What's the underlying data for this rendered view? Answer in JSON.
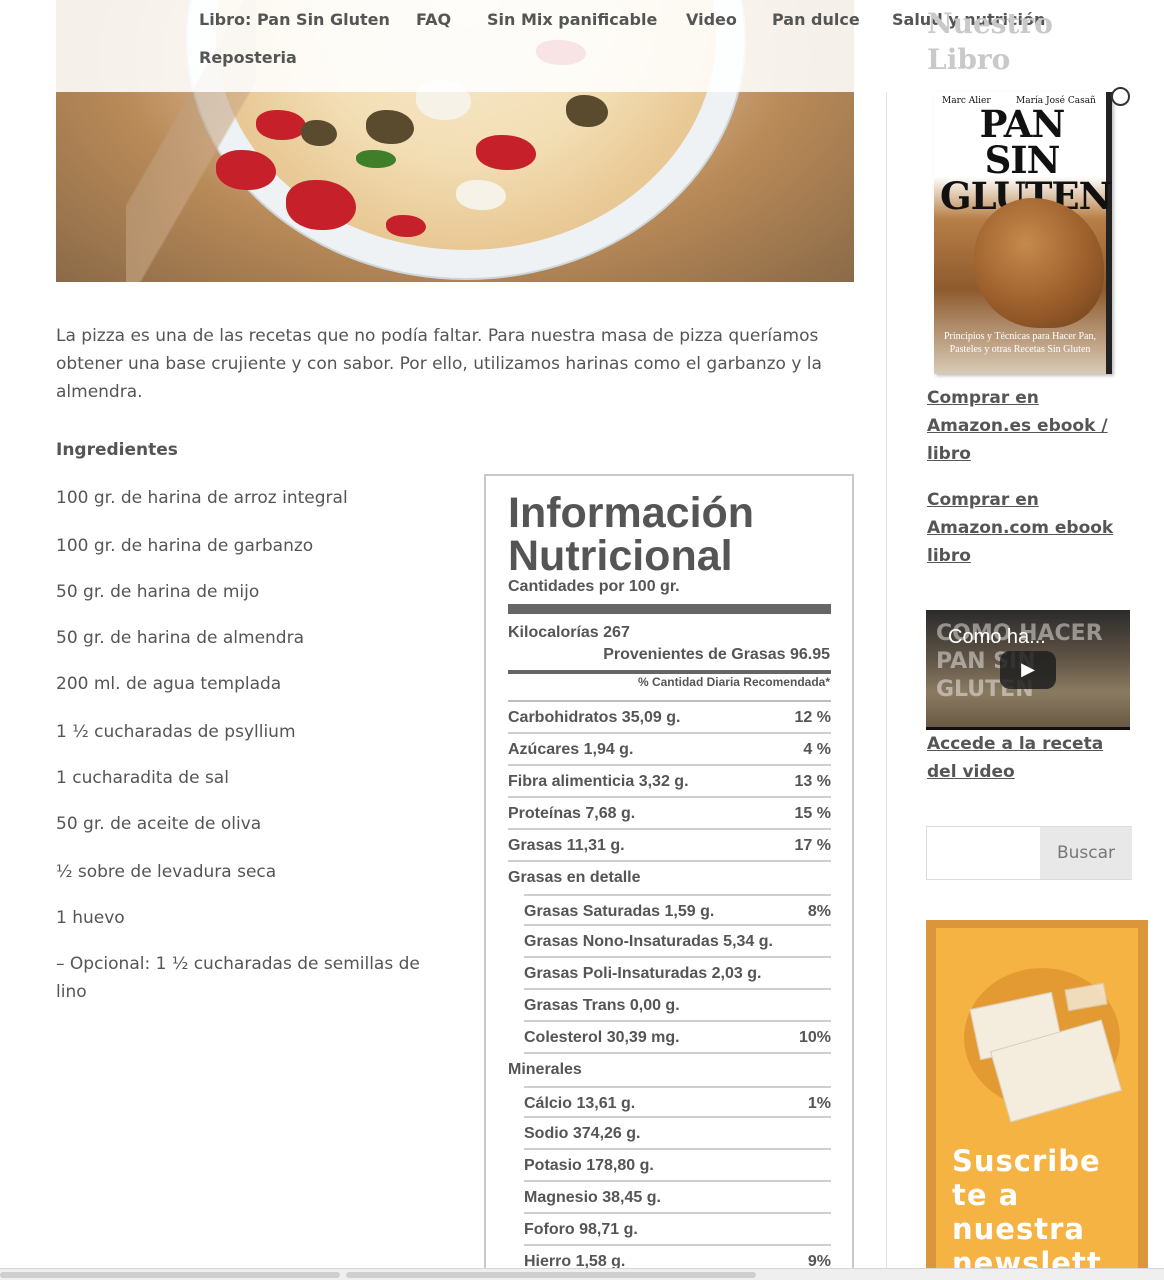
{
  "nav": {
    "items": [
      "Libro: Pan Sin Gluten",
      "FAQ",
      "Sin Mix panificable",
      "Video",
      "Pan dulce",
      "Salud y nutrición",
      "Reposteria"
    ]
  },
  "article": {
    "intro": "La pizza es una de las recetas que no podía faltar. Para nuestra masa de pizza queríamos obtener una base crujiente y con sabor. Por ello, utilizamos harinas como el garbanzo y la almendra.",
    "ingredients_title": "Ingredientes",
    "ingredients": [
      "100 gr. de harina de arroz integral",
      "100 gr. de harina de garbanzo",
      "50 gr. de harina de mijo",
      "50 gr. de harina de almendra",
      "200 ml. de agua templada",
      "1 ½  cucharadas de psyllium",
      "1 cucharadita de sal",
      "50 gr. de aceite de oliva",
      "½  sobre de levadura  seca",
      "1 huevo",
      "– Opcional: 1 ½ cucharadas de semillas de lino"
    ]
  },
  "nutrition": {
    "title_line1": "Información",
    "title_line2": "Nutricional",
    "subtitle": "Cantidades por 100 gr.",
    "kcal": "Kilocalorías 267",
    "fat_cal": "Provenientes de Grasas 96.95",
    "dv_note": "% Cantidad Diaria Recomendada*",
    "rows": [
      {
        "label": "Carbohidratos 35,09 g.",
        "pct": "12 %",
        "indent": false
      },
      {
        "label": "Azúcares 1,94 g.",
        "pct": "4 %",
        "indent": false
      },
      {
        "label": "Fibra alimenticia 3,32 g.",
        "pct": "13 %",
        "indent": false
      },
      {
        "label": "Proteínas 7,68 g.",
        "pct": "15 %",
        "indent": false
      },
      {
        "label": "Grasas 11,31 g.",
        "pct": "17 %",
        "indent": false
      },
      {
        "label": "Grasas en detalle",
        "pct": "",
        "indent": false
      },
      {
        "label": "Grasas Saturadas 1,59 g.",
        "pct": "8%",
        "indent": true
      },
      {
        "label": "Grasas Nono-Insaturadas 5,34 g.",
        "pct": "",
        "indent": true
      },
      {
        "label": "Grasas Poli-Insaturadas 2,03 g.",
        "pct": "",
        "indent": true
      },
      {
        "label": "Grasas Trans 0,00 g.",
        "pct": "",
        "indent": true
      },
      {
        "label": "Colesterol 30,39 mg.",
        "pct": "10%",
        "indent": true
      },
      {
        "label": "Minerales",
        "pct": "",
        "indent": false
      },
      {
        "label": "Cálcio 13,61 g.",
        "pct": "1%",
        "indent": true
      },
      {
        "label": "Sodio 374,26 g.",
        "pct": "",
        "indent": true
      },
      {
        "label": "Potasio 178,80 g.",
        "pct": "",
        "indent": true
      },
      {
        "label": "Magnesio 38,45 g.",
        "pct": "",
        "indent": true
      },
      {
        "label": "Foforo 98,71 g.",
        "pct": "",
        "indent": true
      },
      {
        "label": "Hierro 1,58 g.",
        "pct": "9%",
        "indent": true
      }
    ]
  },
  "sidebar": {
    "book_title": "Nuestro Libro",
    "book": {
      "author_left": "Marc Alier",
      "author_right": "María José Casañ",
      "title": "PAN SIN GLUTEN",
      "caption": "Principios y Técnicas para Hacer Pan, Pasteles y otras Recetas Sin Gluten"
    },
    "buy_es": "Comprar en Amazon.es ebook / libro",
    "buy_com": "Comprar en Amazon.com ebook libro",
    "video_title": "Como ha...",
    "video_brand": "COMO HACER PAN SIN GLUTEN",
    "video_link": "Accede a la receta del video",
    "search_button": "Buscar",
    "search_placeholder": "",
    "newsletter_text": "Suscribe te a nuestra newslett"
  },
  "colors": {
    "text": "#555555",
    "newsletter_bg": "#f5b343",
    "newsletter_border": "#d9963a"
  }
}
